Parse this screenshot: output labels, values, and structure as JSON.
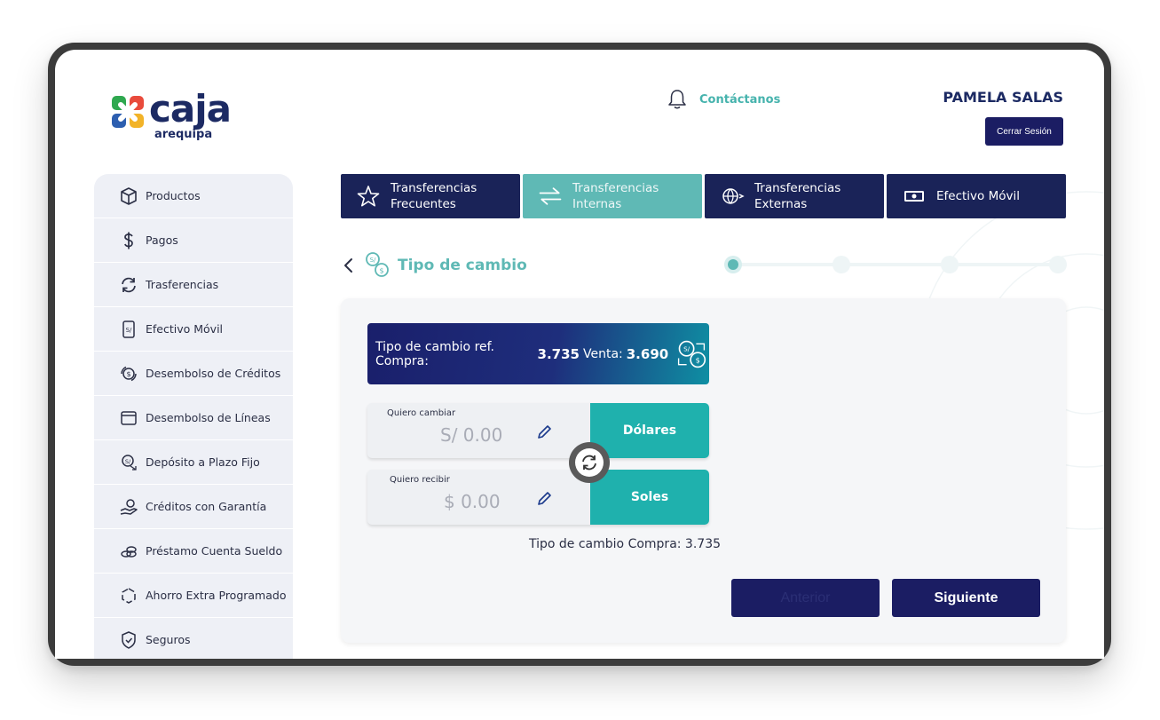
{
  "brand": {
    "name": "caja",
    "sub": "arequipa"
  },
  "header": {
    "contact_label": "Contáctanos",
    "user_name": "PAMELA SALAS",
    "logout_label": "Cerrar Sesión"
  },
  "sidebar": {
    "items": [
      {
        "label": "Productos",
        "icon": "box-icon"
      },
      {
        "label": "Pagos",
        "icon": "dollar-icon"
      },
      {
        "label": "Trasferencias",
        "icon": "refresh-icon"
      },
      {
        "label": "Efectivo Móvil",
        "icon": "phone-money-icon"
      },
      {
        "label": "Desembolso de Créditos",
        "icon": "coin-cycle-icon"
      },
      {
        "label": "Desembolso de Líneas",
        "icon": "wallet-icon"
      },
      {
        "label": "Depósito a Plazo Fijo",
        "icon": "deposit-icon"
      },
      {
        "label": "Créditos con Garantía",
        "icon": "hand-coin-icon"
      },
      {
        "label": "Préstamo Cuenta Sueldo",
        "icon": "coins-stack-icon"
      },
      {
        "label": "Ahorro Extra Programado",
        "icon": "cycle-arrows-icon"
      },
      {
        "label": "Seguros",
        "icon": "shield-icon"
      }
    ]
  },
  "tabs": [
    {
      "line1": "Transferencias",
      "line2": "Frecuentes",
      "icon": "star-icon"
    },
    {
      "line1": "Transferencias",
      "line2": "Internas",
      "icon": "swap-arrows-icon"
    },
    {
      "line1": "Transferencias",
      "line2": "Externas",
      "icon": "globe-icon"
    },
    {
      "line1": "Efectivo Móvil",
      "line2": "",
      "icon": "cash-icon"
    }
  ],
  "active_tab_index": 1,
  "page": {
    "title": "Tipo de cambio"
  },
  "stepper": {
    "total_steps": 4,
    "current_step": 1
  },
  "exchange": {
    "banner_prefix": "Tipo de cambio ref. Compra:",
    "buy_rate": "3.735",
    "sell_label": "Venta:",
    "sell_rate": "3.690",
    "from": {
      "label": "Quiero cambiar",
      "value": "S/ 0.00",
      "currency": "Dólares"
    },
    "to": {
      "label": "Quiero recibir",
      "value": "$ 0.00",
      "currency": "Soles"
    },
    "rate_note": "Tipo de cambio Compra: 3.735"
  },
  "actions": {
    "back_label": "Anterior",
    "next_label": "Siguiente"
  },
  "colors": {
    "navy": "#1b1d63",
    "teal": "#5fb9b5",
    "teal_button": "#1fb1ad",
    "sidebar_bg": "#eef0f6"
  }
}
